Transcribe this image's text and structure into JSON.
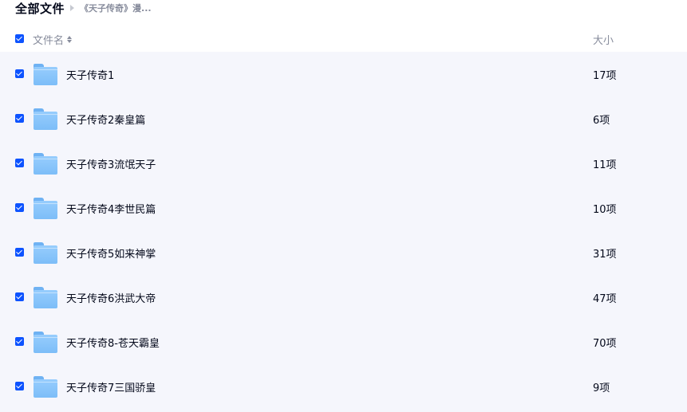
{
  "breadcrumb": {
    "root": "全部文件",
    "current": "《天子传奇》漫..."
  },
  "header": {
    "name_label": "文件名",
    "size_label": "大小"
  },
  "files": [
    {
      "name": "天子传奇1",
      "size": "17项"
    },
    {
      "name": "天子传奇2秦皇篇",
      "size": "6项"
    },
    {
      "name": "天子传奇3流氓天子",
      "size": "11项"
    },
    {
      "name": "天子传奇4李世民篇",
      "size": "10项"
    },
    {
      "name": "天子传奇5如来神掌",
      "size": "31项"
    },
    {
      "name": "天子传奇6洪武大帝",
      "size": "47项"
    },
    {
      "name": "天子传奇8-苍天霸皇",
      "size": "70项"
    },
    {
      "name": "天子传奇7三国骄皇",
      "size": "9项"
    }
  ],
  "icons": {
    "folder": "folder-icon",
    "checkbox": "checkbox-checked-icon",
    "sort": "sort-icon",
    "separator": "breadcrumb-arrow-icon"
  },
  "colors": {
    "accent": "#0d53ff",
    "list_background": "#f5f6fc",
    "muted_text": "#878c9c",
    "folder": "#8cc6fb"
  }
}
